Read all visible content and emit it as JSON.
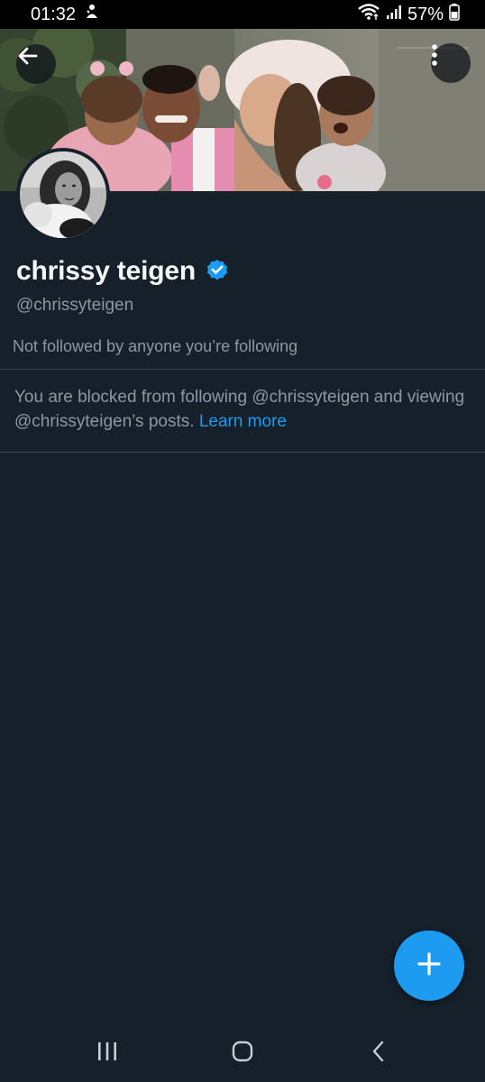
{
  "status_bar": {
    "time": "01:32",
    "battery_percent": "57%",
    "icons": [
      "notification-icon",
      "wifi-icon",
      "signal-icon",
      "battery-icon"
    ]
  },
  "header": {
    "back_icon": "arrow-left-icon",
    "more_icon": "more-vertical-icon"
  },
  "profile": {
    "display_name": "chrissy teigen",
    "verified": true,
    "handle": "@chrissyteigen",
    "followers_note": "Not followed by anyone you’re following"
  },
  "blocked_notice": {
    "message": "You are blocked from following @chrissyteigen and viewing @chrissyteigen’s posts.",
    "link_label": "Learn more"
  },
  "fab": {
    "icon": "plus-icon"
  },
  "nav_bar": {
    "icons": [
      "recent-apps-icon",
      "home-icon",
      "back-icon"
    ]
  },
  "colors": {
    "background": "#15202b",
    "accent": "#1d9bf0",
    "secondary_text": "#8b98a5",
    "divider": "#38444d"
  }
}
